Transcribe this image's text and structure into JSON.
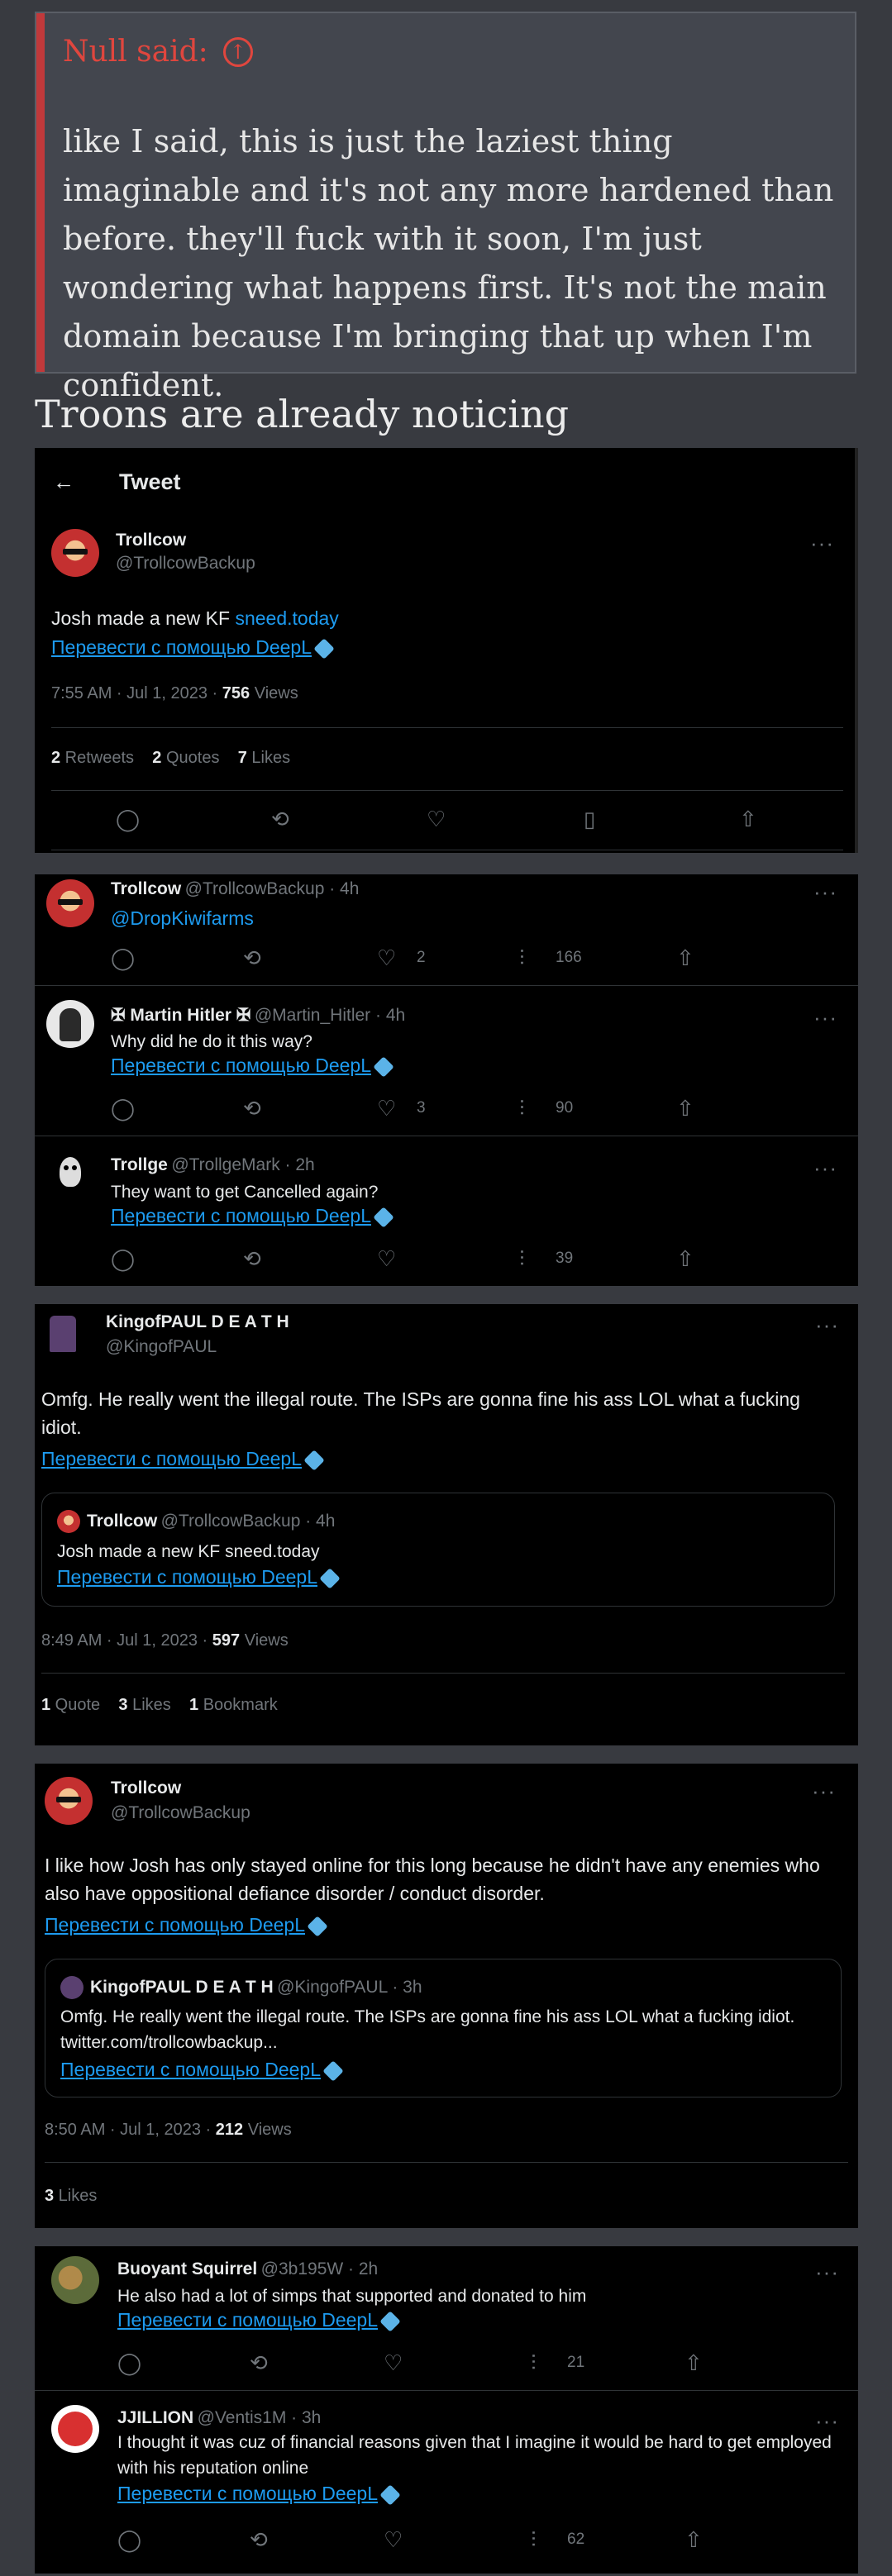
{
  "quote": {
    "author": "Null said:",
    "body": "like I said, this is just the laziest thing imaginable and it's not any more hardened than before. they'll fuck with it soon, I'm just wondering what happens first. It's not the main domain because I'm bringing that up when I'm confident."
  },
  "post_text": "Troons are already noticing",
  "translate_label": "Перевести с помощью DeepL",
  "tweet1": {
    "header": "Tweet",
    "name": "Trollcow",
    "handle": "@TrollcowBackup",
    "text": "Josh made a new KF ",
    "link": "sneed.today",
    "time": "7:55 AM · Jul 1, 2023 · ",
    "views_num": "756",
    "views_label": " Views",
    "retweets_num": "2",
    "retweets_label": " Retweets",
    "quotes_num": "2",
    "quotes_label": " Quotes",
    "likes_num": "7",
    "likes_label": " Likes"
  },
  "replies": [
    {
      "name": "Trollcow",
      "meta": "@TrollcowBackup · 4h",
      "text": "",
      "mention": "@DropKiwifarms",
      "likes": "2",
      "views": "166"
    },
    {
      "name": "✠ Martin Hitler ✠",
      "meta": "@Martin_Hitler · 4h",
      "text": "Why did he do it this way?",
      "likes": "3",
      "views": "90"
    },
    {
      "name": "Trollge",
      "meta": "@TrollgeMark · 2h",
      "text": "They want to get Cancelled again?",
      "likes": "",
      "views": "39"
    }
  ],
  "tweet3": {
    "name": "KingofPAUL D E A T H",
    "handle": "@KingofPAUL",
    "text": "Omfg. He really went the illegal route. The ISPs are gonna fine his ass LOL what a fucking idiot.",
    "quoted_name": "Trollcow",
    "quoted_meta": "@TrollcowBackup · 4h",
    "quoted_text": "Josh made a new KF sneed.today",
    "time": "8:49 AM · Jul 1, 2023 · ",
    "views_num": "597",
    "views_label": " Views",
    "quote_num": "1",
    "quote_label": " Quote",
    "likes_num": "3",
    "likes_label": " Likes",
    "bookmark_num": "1",
    "bookmark_label": " Bookmark"
  },
  "tweet4": {
    "name": "Trollcow",
    "handle": "@TrollcowBackup",
    "text": "I like how Josh has only stayed online for this long because he didn't have any enemies who also have oppositional defiance disorder / conduct disorder.",
    "quoted_name": "KingofPAUL D E A T H",
    "quoted_meta": "@KingofPAUL · 3h",
    "quoted_text": "Omfg. He really went the illegal route. The ISPs are gonna fine his ass LOL what a fucking idiot. twitter.com/trollcowbackup...",
    "time": "8:50 AM · Jul 1, 2023 · ",
    "views_num": "212",
    "views_label": " Views",
    "likes_num": "3",
    "likes_label": " Likes"
  },
  "replies2": [
    {
      "name": "Buoyant Squirrel",
      "meta": "@3b195W · 2h",
      "text": "He also had a lot of simps that supported and donated to him",
      "views": "21"
    },
    {
      "name": "JJILLION",
      "meta": "@Ventis1M · 3h",
      "text": "I thought it was cuz of financial reasons given that I imagine it would be hard to get employed with his reputation online",
      "views": "62"
    }
  ],
  "icons": {
    "back": "←",
    "more": "···",
    "reply": "💬",
    "retweet": "⟲",
    "like": "♡",
    "bookmark": "⌂",
    "share": "⇧",
    "views": "⫶"
  },
  "colors": {
    "accent_red": "#e0463e",
    "link_blue": "#1d9bf0",
    "tweet_bg": "#000000",
    "forum_bg": "#383a40"
  }
}
